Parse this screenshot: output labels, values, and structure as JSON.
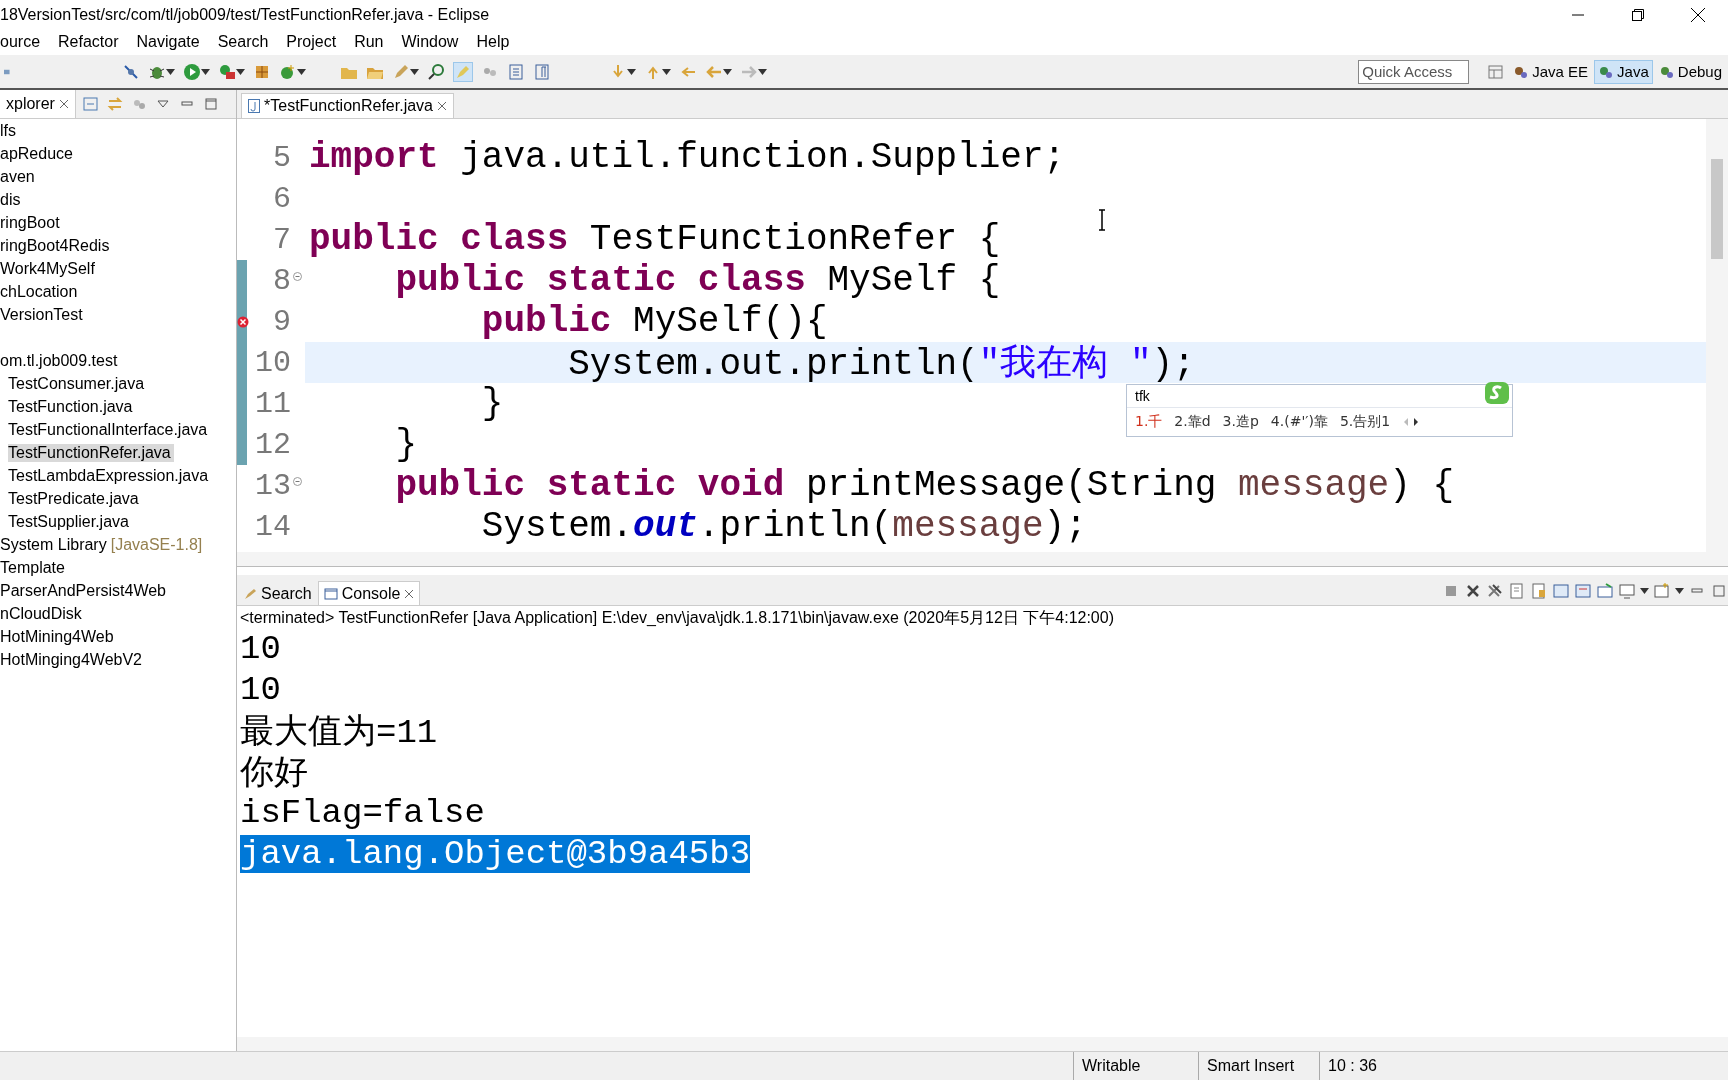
{
  "window": {
    "title": "18VersionTest/src/com/tl/job009/test/TestFunctionRefer.java - Eclipse"
  },
  "menu": [
    "ource",
    "Refactor",
    "Navigate",
    "Search",
    "Project",
    "Run",
    "Window",
    "Help"
  ],
  "toolbar": {
    "quick_access": {
      "placeholder": "Quick Access"
    },
    "perspectives": [
      {
        "label": "Java EE",
        "selected": false
      },
      {
        "label": "Java",
        "selected": true
      },
      {
        "label": "Debug",
        "selected": false
      }
    ]
  },
  "explorer": {
    "tab": "xplorer",
    "items": [
      {
        "label": "lfs",
        "selected": false
      },
      {
        "label": "apReduce",
        "selected": false
      },
      {
        "label": "aven",
        "selected": false
      },
      {
        "label": "dis",
        "selected": false
      },
      {
        "label": "ringBoot",
        "selected": false
      },
      {
        "label": "ringBoot4Redis",
        "selected": false
      },
      {
        "label": "Work4MySelf",
        "selected": false
      },
      {
        "label": "chLocation",
        "selected": false
      },
      {
        "label": "VersionTest",
        "selected": false
      },
      {
        "label": "om.tl.job009.test",
        "selected": false,
        "children": [
          {
            "label": "TestConsumer.java",
            "selected": false
          },
          {
            "label": "TestFunction.java",
            "selected": false
          },
          {
            "label": "TestFunctionalInterface.java",
            "selected": false
          },
          {
            "label": "TestFunctionRefer.java",
            "selected": true
          },
          {
            "label": "TestLambdaExpression.java",
            "selected": false
          },
          {
            "label": "TestPredicate.java",
            "selected": false
          },
          {
            "label": "TestSupplier.java",
            "selected": false
          }
        ]
      },
      {
        "label": "System Library",
        "decoration": "[JavaSE-1.8]",
        "selected": false
      },
      {
        "label": "Template",
        "selected": false
      },
      {
        "label": "ParserAndPersist4Web",
        "selected": false
      },
      {
        "label": "nCloudDisk",
        "selected": false
      },
      {
        "label": "HotMining4Web",
        "selected": false
      },
      {
        "label": "HotMinging4WebV2",
        "selected": false
      }
    ]
  },
  "editor": {
    "tab": "*TestFunctionRefer.java",
    "lines": [
      {
        "number": "5",
        "current": false,
        "changed": false,
        "error": false,
        "fold": false,
        "tokens": [
          {
            "kind": "keyword",
            "text": "import"
          },
          {
            "kind": "plain",
            "text": " java.util.function.Supplier;"
          }
        ]
      },
      {
        "number": "6",
        "current": false,
        "changed": false,
        "error": false,
        "fold": false
      },
      {
        "number": "7",
        "current": false,
        "changed": false,
        "error": false,
        "fold": false,
        "tokens": [
          {
            "kind": "keyword",
            "text": "public class"
          },
          {
            "kind": "plain",
            "text": " TestFunctionRefer {"
          }
        ]
      },
      {
        "number": "8",
        "current": false,
        "changed": true,
        "error": false,
        "fold": true,
        "tokens": [
          {
            "kind": "keyword",
            "text": "    public static class"
          },
          {
            "kind": "plain",
            "text": " MySelf {"
          }
        ]
      },
      {
        "number": "9",
        "current": false,
        "changed": true,
        "error": true,
        "fold": false,
        "tokens": [
          {
            "kind": "keyword",
            "text": "        public"
          },
          {
            "kind": "plain",
            "text": " MySelf(){"
          }
        ]
      },
      {
        "number": "10",
        "current": true,
        "changed": true,
        "error": false,
        "fold": false,
        "tokens": [
          {
            "kind": "plain",
            "text": "            System.out.println("
          },
          {
            "kind": "string",
            "text": "\"我在构 \""
          },
          {
            "kind": "plain",
            "text": ");"
          }
        ]
      },
      {
        "number": "11",
        "current": false,
        "changed": true,
        "error": false,
        "fold": false,
        "tokens": [
          {
            "kind": "plain",
            "text": "        }"
          }
        ]
      },
      {
        "number": "12",
        "current": false,
        "changed": true,
        "error": false,
        "fold": false,
        "tokens": [
          {
            "kind": "plain",
            "text": "    }"
          }
        ]
      },
      {
        "number": "13",
        "current": false,
        "changed": false,
        "error": false,
        "fold": true,
        "tokens": [
          {
            "kind": "keyword",
            "text": "    public static void"
          },
          {
            "kind": "plain",
            "text": " printMessage(String "
          },
          {
            "kind": "param",
            "text": "message"
          },
          {
            "kind": "plain",
            "text": ") {"
          }
        ]
      },
      {
        "number": "14",
        "current": false,
        "changed": false,
        "error": false,
        "fold": false,
        "tokens": [
          {
            "kind": "plain",
            "text": "        System."
          },
          {
            "kind": "field",
            "text": "out"
          },
          {
            "kind": "plain",
            "text": ".println("
          },
          {
            "kind": "param",
            "text": "message"
          },
          {
            "kind": "plain",
            "text": ");"
          }
        ]
      }
    ],
    "ime": {
      "input": "tfk",
      "candidates": [
        {
          "text": "1.千",
          "selected": true
        },
        {
          "text": "2.靠d",
          "selected": false
        },
        {
          "text": "3.造p",
          "selected": false
        },
        {
          "text": "4.(#'′)靠",
          "selected": false
        },
        {
          "text": "5.告别1",
          "selected": false
        }
      ]
    }
  },
  "console_panel": {
    "tabs": [
      {
        "label": "Search",
        "selected": false
      },
      {
        "label": "Console",
        "selected": true
      }
    ],
    "header": "<terminated> TestFunctionRefer [Java Application] E:\\dev_env\\java\\jdk.1.8.171\\bin\\javaw.exe (2020年5月12日 下午4:12:00)",
    "lines": [
      {
        "text": "10",
        "selected": false
      },
      {
        "text": "10",
        "selected": false
      },
      {
        "text": "最大值为=11",
        "selected": false
      },
      {
        "text": "你好",
        "selected": false
      },
      {
        "text": "isFlag=false",
        "selected": false
      },
      {
        "text": "java.lang.Object@3b9a45b3",
        "selected": true
      }
    ]
  },
  "status_bar": [
    "Writable",
    "Smart Insert",
    "10 : 36"
  ]
}
